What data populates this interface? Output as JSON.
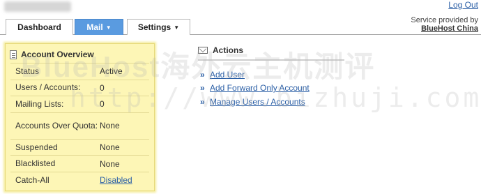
{
  "header": {
    "logout_label": "Log Out",
    "provider_line": "Service provided by",
    "provider_name": "BlueHost China"
  },
  "tabs": [
    {
      "label": "Dashboard",
      "active": false,
      "dropdown": false
    },
    {
      "label": "Mail",
      "active": true,
      "dropdown": true
    },
    {
      "label": "Settings",
      "active": false,
      "dropdown": true
    }
  ],
  "overview": {
    "title": "Account Overview",
    "icon": "document-icon",
    "rows": [
      {
        "label": "Status",
        "value": "Active"
      },
      {
        "label": "Users / Accounts:",
        "value": "0"
      },
      {
        "label": "Mailing Lists:",
        "value": "0"
      },
      {
        "label": "Accounts Over Quota:",
        "value": "None"
      },
      {
        "label": "Suspended",
        "value": "None"
      },
      {
        "label": "Blacklisted",
        "value": "None"
      },
      {
        "label": "Catch-All",
        "value": "Disabled"
      }
    ]
  },
  "actions": {
    "title": "Actions",
    "icon": "envelope-icon",
    "bullet": "»",
    "items": [
      {
        "label": "Add User"
      },
      {
        "label": "Add Forward Only Account"
      },
      {
        "label": "Manage Users / Accounts"
      }
    ]
  },
  "watermark": {
    "line1": "BlueHost海外云主机测评",
    "line2": "http://www.bizhuji.com/"
  },
  "colors": {
    "tab_active": "#5a9be0",
    "link": "#2b5fa6",
    "panel_bg": "#fdf6b6"
  }
}
